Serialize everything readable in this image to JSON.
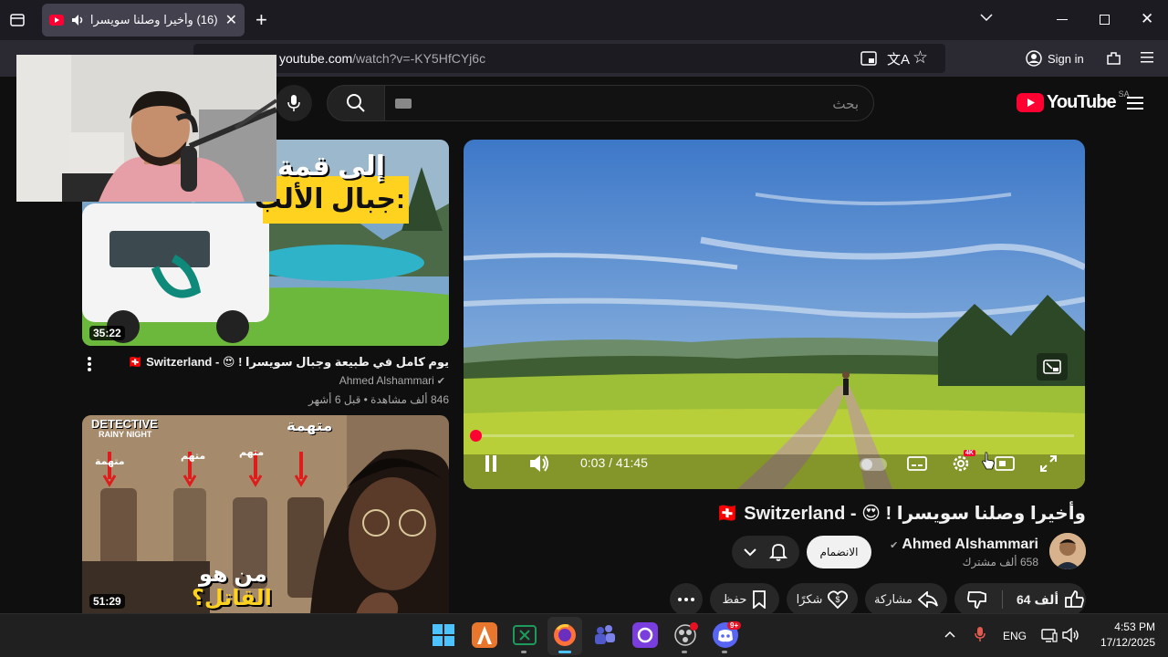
{
  "browser": {
    "tab_title": "(16) وأخيرا وصلنا سويسرا !",
    "url_host": "youtube.com",
    "url_path": "/watch?v=-KY5HfCYj6c",
    "sign_in_label": "Sign in"
  },
  "header": {
    "logo_text": "YouTube",
    "region": "SA",
    "search_placeholder": "بحث"
  },
  "sidebar_videos": [
    {
      "thumb_text_line1": "إلى قمة",
      "thumb_text_line2": "جبال الألب:",
      "duration": "35:22",
      "title": "يوم كامل في طبيعة وجبال سويسرا ! 😍 - 🇨🇭 Switzerland",
      "channel": "Ahmed Alshammari",
      "meta": "846 ألف مشاهدة • قبل 6 أشهر"
    },
    {
      "thumb_text_top": "DETECTIVE",
      "thumb_text_sub": "RAINY NIGHT",
      "thumb_labels": [
        "متهمة",
        "متهم",
        "متهم",
        "متهمة"
      ],
      "thumb_text_line1": "من هو",
      "thumb_text_line2": "القاتل؟",
      "duration": "51:29"
    }
  ],
  "player": {
    "time_current": "0:03",
    "time_total": "41:45",
    "time_display": "0:03 / 41:45",
    "progress_fraction": 0.0012,
    "quality_badge": "4K"
  },
  "video": {
    "title": "وأخيرا وصلنا سويسرا ! 😍 - 🇨🇭 Switzerland",
    "channel_name": "Ahmed Alshammari",
    "subscribers": "658 ألف مشترك",
    "join_label": "الانضمام",
    "like_count": "64 ألف",
    "share_label": "مشاركة",
    "thanks_label": "شكرًا",
    "save_label": "حفظ"
  },
  "taskbar": {
    "lang": "ENG",
    "time": "4:53 PM",
    "date": "17/12/2025",
    "discord_badge": "9+"
  },
  "colors": {
    "youtube_red": "#ff0033",
    "page_bg": "#0f0f0f",
    "pill_bg": "#272727"
  }
}
